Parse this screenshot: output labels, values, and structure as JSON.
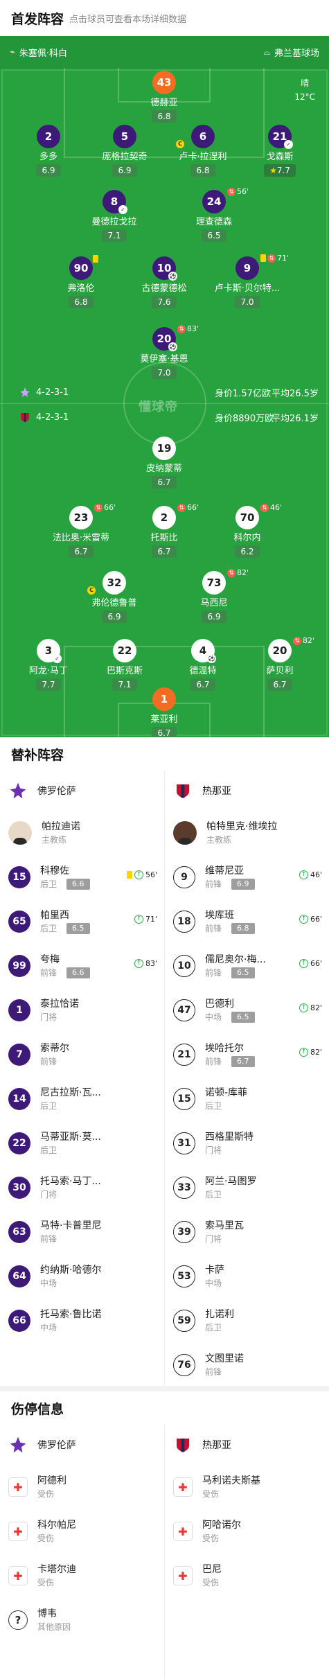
{
  "header": {
    "title": "首发阵容",
    "subtitle": "点击球员可查看本场详细数据"
  },
  "pitch": {
    "home_coach": "朱塞佩·科白",
    "away_coach": "弗兰基球场",
    "weather": "晴",
    "temperature": "12°C",
    "watermark": "懂球帝",
    "home_formation": "4-2-3-1",
    "home_value": "身价1.57亿欧",
    "home_age": "平均26.5岁",
    "away_formation": "4-2-3-1",
    "away_value": "身价8890万欧",
    "away_age": "平均26.1岁",
    "colors": {
      "pitch": "#27a23e",
      "home": "#3d1a78",
      "away_gk": "#f26d22"
    }
  },
  "home_players": [
    {
      "num": "43",
      "name": "德赫亚",
      "rating": "6.8"
    },
    {
      "num": "2",
      "name": "多多",
      "rating": "6.9"
    },
    {
      "num": "5",
      "name": "庞格拉契奇",
      "rating": "6.9"
    },
    {
      "num": "6",
      "name": "卢卡·拉涅利",
      "rating": "6.8"
    },
    {
      "num": "21",
      "name": "戈森斯",
      "rating": "7.7"
    },
    {
      "num": "8",
      "name": "曼德拉戈拉",
      "rating": "7.1"
    },
    {
      "num": "24",
      "name": "理查德森",
      "rating": "6.5",
      "event": "56'"
    },
    {
      "num": "90",
      "name": "弗洛伦",
      "rating": "6.8"
    },
    {
      "num": "10",
      "name": "古德蒙德松",
      "rating": "7.6"
    },
    {
      "num": "9",
      "name": "卢卡斯·贝尔特...",
      "rating": "7.0",
      "event": "71'"
    },
    {
      "num": "20",
      "name": "莫伊塞·基恩",
      "rating": "7.0",
      "event": "83'"
    }
  ],
  "away_players": [
    {
      "num": "19",
      "name": "皮纳蒙蒂",
      "rating": "6.7"
    },
    {
      "num": "23",
      "name": "法比奥·米雷蒂",
      "rating": "6.7",
      "event": "66'"
    },
    {
      "num": "2",
      "name": "托斯比",
      "rating": "6.7",
      "event": "66'"
    },
    {
      "num": "70",
      "name": "科尔内",
      "rating": "6.2",
      "event": "46'"
    },
    {
      "num": "32",
      "name": "弗伦德鲁普",
      "rating": "6.9"
    },
    {
      "num": "73",
      "name": "马西尼",
      "rating": "6.9",
      "event": "82'"
    },
    {
      "num": "3",
      "name": "阿龙·马丁",
      "rating": "7.7"
    },
    {
      "num": "22",
      "name": "巴斯克斯",
      "rating": "7.1"
    },
    {
      "num": "4",
      "name": "德温特",
      "rating": "6.7"
    },
    {
      "num": "20",
      "name": "萨贝利",
      "rating": "6.7",
      "event": "82'"
    },
    {
      "num": "1",
      "name": "莱亚利",
      "rating": "6.7"
    }
  ],
  "subs": {
    "title": "替补阵容",
    "home_team": "佛罗伦萨",
    "away_team": "热那亚",
    "home_coach": {
      "name": "帕拉迪诺",
      "role": "主教练"
    },
    "away_coach": {
      "name": "帕特里克·维埃拉",
      "role": "主教练"
    },
    "home": [
      {
        "num": "15",
        "name": "科穆佐",
        "pos": "后卫",
        "rating": "6.6",
        "event": "56'",
        "card": true
      },
      {
        "num": "65",
        "name": "帕里西",
        "pos": "后卫",
        "rating": "6.5",
        "event": "71'"
      },
      {
        "num": "99",
        "name": "夸梅",
        "pos": "前锋",
        "rating": "6.6",
        "event": "83'"
      },
      {
        "num": "1",
        "name": "泰拉恰诺",
        "pos": "门将"
      },
      {
        "num": "7",
        "name": "索蒂尔",
        "pos": "前锋"
      },
      {
        "num": "14",
        "name": "尼古拉斯·瓦...",
        "pos": "后卫"
      },
      {
        "num": "22",
        "name": "马蒂亚斯·莫...",
        "pos": "后卫"
      },
      {
        "num": "30",
        "name": "托马索·马丁...",
        "pos": "门将"
      },
      {
        "num": "63",
        "name": "马特·卡普里尼",
        "pos": "前锋"
      },
      {
        "num": "64",
        "name": "约纳斯·哈德尔",
        "pos": "中场"
      },
      {
        "num": "66",
        "name": "托马索·鲁比诺",
        "pos": "中场"
      }
    ],
    "away": [
      {
        "num": "9",
        "name": "维蒂尼亚",
        "pos": "前锋",
        "rating": "6.9",
        "event": "46'"
      },
      {
        "num": "18",
        "name": "埃库班",
        "pos": "前锋",
        "rating": "6.8",
        "event": "66'"
      },
      {
        "num": "10",
        "name": "儒尼奥尔·梅...",
        "pos": "前锋",
        "rating": "6.5",
        "event": "66'"
      },
      {
        "num": "47",
        "name": "巴德利",
        "pos": "中场",
        "rating": "6.5",
        "event": "82'"
      },
      {
        "num": "21",
        "name": "埃哈托尔",
        "pos": "前锋",
        "rating": "6.7",
        "event": "82'"
      },
      {
        "num": "15",
        "name": "诺顿-库菲",
        "pos": "后卫"
      },
      {
        "num": "31",
        "name": "西格里斯特",
        "pos": "门将"
      },
      {
        "num": "33",
        "name": "阿兰·马图罗",
        "pos": "后卫"
      },
      {
        "num": "39",
        "name": "索马里瓦",
        "pos": "门将"
      },
      {
        "num": "53",
        "name": "卡萨",
        "pos": "中场"
      },
      {
        "num": "59",
        "name": "扎诺利",
        "pos": "后卫"
      },
      {
        "num": "76",
        "name": "文图里诺",
        "pos": "前锋"
      }
    ]
  },
  "injuries": {
    "title": "伤停信息",
    "home_team": "佛罗伦萨",
    "away_team": "热那亚",
    "home": [
      {
        "name": "阿德利",
        "status": "受伤"
      },
      {
        "name": "科尔帕尼",
        "status": "受伤"
      },
      {
        "name": "卡塔尔迪",
        "status": "受伤"
      },
      {
        "name": "博韦",
        "status": "其他原因"
      }
    ],
    "away": [
      {
        "name": "马利诺夫斯基",
        "status": "受伤"
      },
      {
        "name": "阿哈诺尔",
        "status": "受伤"
      },
      {
        "name": "巴尼",
        "status": "受伤"
      }
    ]
  }
}
